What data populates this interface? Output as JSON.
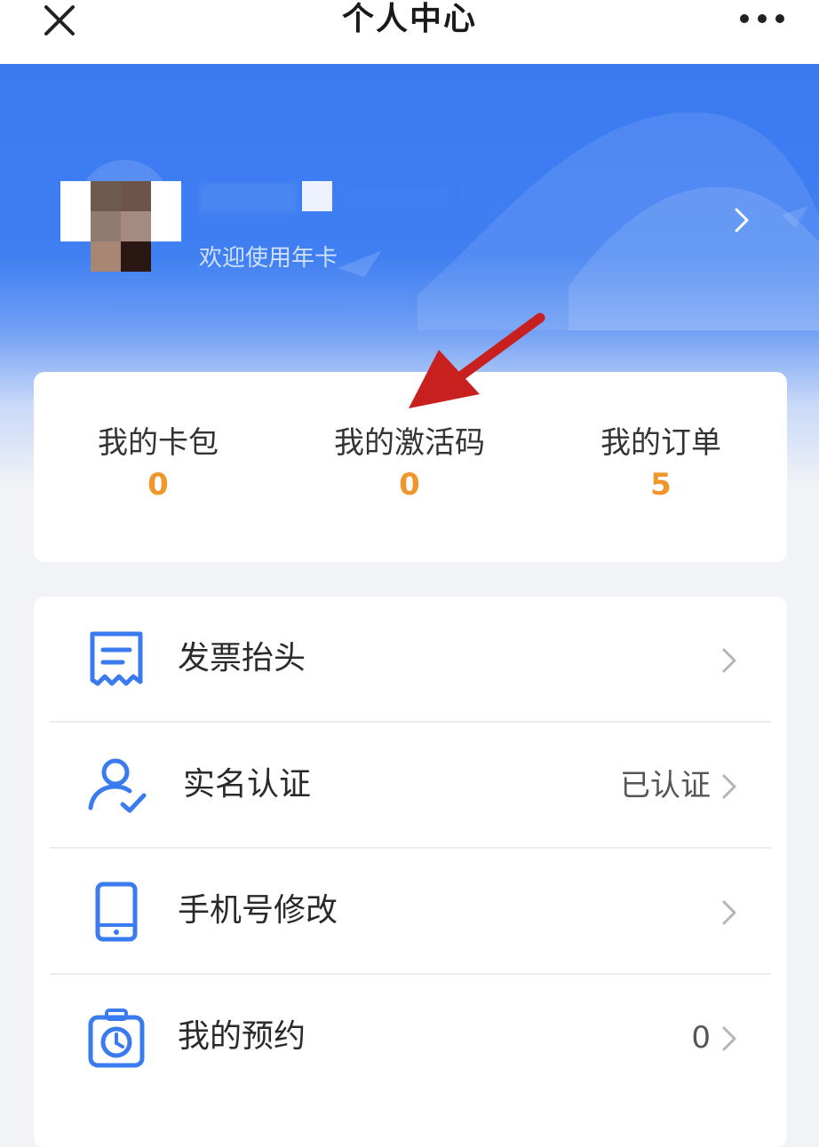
{
  "navbar": {
    "title": "个人中心",
    "close_icon": "close-icon",
    "more_icon": "more-icon"
  },
  "profile": {
    "subtitle": "欢迎使用年卡",
    "arrow_icon": "chevron-right-icon"
  },
  "stats": [
    {
      "label": "我的卡包",
      "value": "0"
    },
    {
      "label": "我的激活码",
      "value": "0"
    },
    {
      "label": "我的订单",
      "value": "5"
    }
  ],
  "menu": [
    {
      "label": "发票抬头",
      "value": "",
      "icon": "invoice-icon"
    },
    {
      "label": "实名认证",
      "value": "已认证",
      "icon": "user-verified-icon"
    },
    {
      "label": "手机号修改",
      "value": "",
      "icon": "phone-icon"
    },
    {
      "label": "我的预约",
      "value": "0",
      "icon": "clock-icon"
    }
  ],
  "colors": {
    "brand_blue": "#3b79f1",
    "stat_value": "#f0962a",
    "icon_blue": "#3a7bf0"
  }
}
